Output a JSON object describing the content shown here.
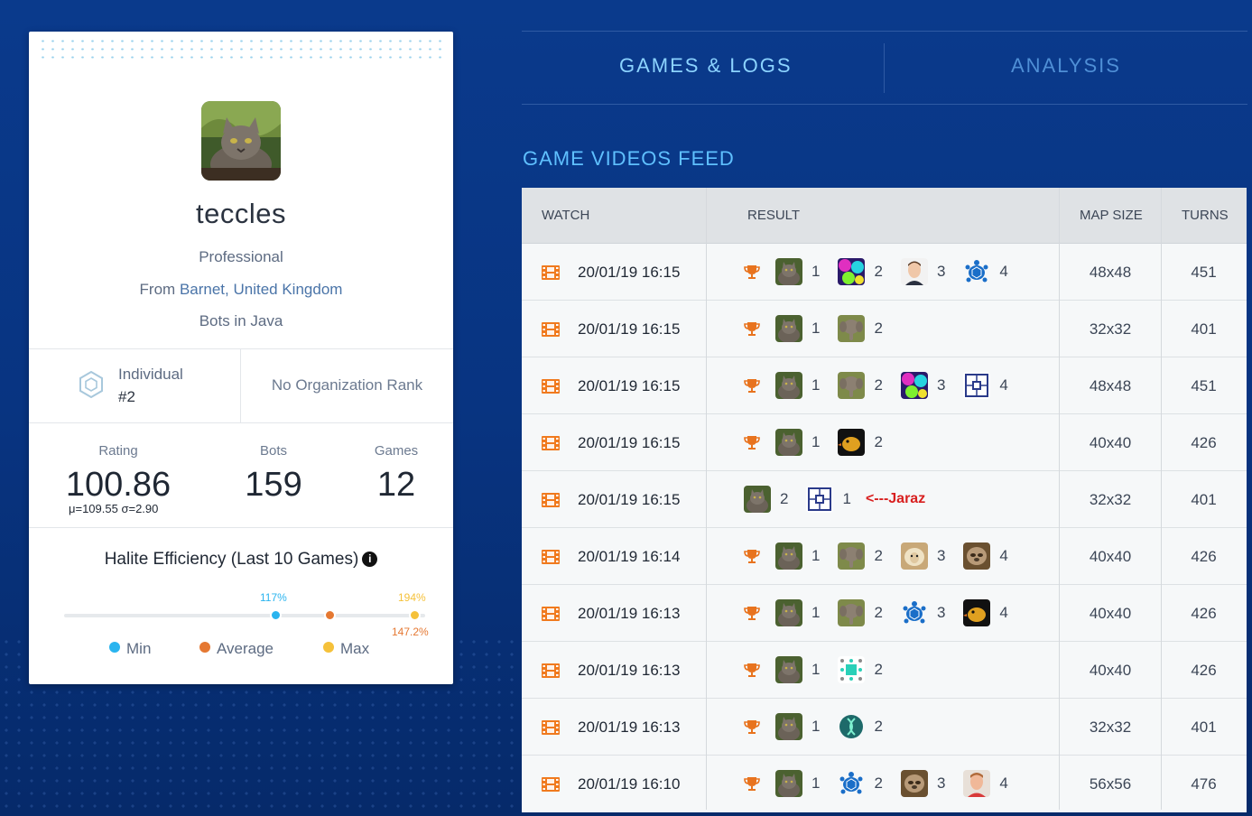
{
  "profile": {
    "username": "teccles",
    "level": "Professional",
    "from_prefix": "From ",
    "location": "Barnet, United Kingdom",
    "bots_in": "Bots in Java",
    "rank_type": "Individual",
    "rank_value": "#2",
    "org_rank": "No Organization Rank",
    "stats": {
      "rating_label": "Rating",
      "rating_value": "100.86",
      "rating_sub": "μ=109.55 σ=2.90",
      "bots_label": "Bots",
      "bots_value": "159",
      "games_label": "Games",
      "games_value": "12"
    },
    "efficiency": {
      "title": "Halite Efficiency (Last 10 Games)",
      "min_pct": "117%",
      "avg_pct": "147.2%",
      "max_pct": "194%",
      "min_value": 117,
      "avg_value": 147.2,
      "max_value": 194,
      "legend_min": "Min",
      "legend_avg": "Average",
      "legend_max": "Max",
      "colors": {
        "min": "#2ab4ef",
        "avg": "#e57832",
        "max": "#f5c13a"
      }
    }
  },
  "tabs": [
    {
      "label": "GAMES & LOGS",
      "active": true
    },
    {
      "label": "ANALYSIS",
      "active": false
    }
  ],
  "feed": {
    "title": "GAME VIDEOS FEED",
    "headers": {
      "watch": "WATCH",
      "result": "RESULT",
      "map_size": "MAP SIZE",
      "turns": "TURNS"
    },
    "rows": [
      {
        "date": "20/01/19 16:15",
        "trophy": true,
        "players": [
          [
            "cat",
            "1"
          ],
          [
            "neon",
            "2"
          ],
          [
            "man",
            "3"
          ],
          [
            "turtle",
            "4"
          ]
        ],
        "note": "",
        "map": "48x48",
        "turns": "451"
      },
      {
        "date": "20/01/19 16:15",
        "trophy": true,
        "players": [
          [
            "cat",
            "1"
          ],
          [
            "elephant",
            "2"
          ]
        ],
        "note": "",
        "map": "32x32",
        "turns": "401"
      },
      {
        "date": "20/01/19 16:15",
        "trophy": true,
        "players": [
          [
            "cat",
            "1"
          ],
          [
            "elephant",
            "2"
          ],
          [
            "neon",
            "3"
          ],
          [
            "quilt",
            "4"
          ]
        ],
        "note": "",
        "map": "48x48",
        "turns": "451"
      },
      {
        "date": "20/01/19 16:15",
        "trophy": true,
        "players": [
          [
            "cat",
            "1"
          ],
          [
            "bird",
            "2"
          ]
        ],
        "note": "",
        "map": "40x40",
        "turns": "426"
      },
      {
        "date": "20/01/19 16:15",
        "trophy": false,
        "players": [
          [
            "cat",
            "2"
          ],
          [
            "quilt",
            "1"
          ]
        ],
        "note": "<---Jaraz",
        "map": "32x32",
        "turns": "401"
      },
      {
        "date": "20/01/19 16:14",
        "trophy": true,
        "players": [
          [
            "cat",
            "1"
          ],
          [
            "elephant",
            "2"
          ],
          [
            "sheep",
            "3"
          ],
          [
            "sloth",
            "4"
          ]
        ],
        "note": "",
        "map": "40x40",
        "turns": "426"
      },
      {
        "date": "20/01/19 16:13",
        "trophy": true,
        "players": [
          [
            "cat",
            "1"
          ],
          [
            "elephant",
            "2"
          ],
          [
            "turtle",
            "3"
          ],
          [
            "bird",
            "4"
          ]
        ],
        "note": "",
        "map": "40x40",
        "turns": "426"
      },
      {
        "date": "20/01/19 16:13",
        "trophy": true,
        "players": [
          [
            "cat",
            "1"
          ],
          [
            "pattern",
            "2"
          ]
        ],
        "note": "",
        "map": "40x40",
        "turns": "426"
      },
      {
        "date": "20/01/19 16:13",
        "trophy": true,
        "players": [
          [
            "cat",
            "1"
          ],
          [
            "dna",
            "2"
          ]
        ],
        "note": "",
        "map": "32x32",
        "turns": "401"
      },
      {
        "date": "20/01/19 16:10",
        "trophy": true,
        "players": [
          [
            "cat",
            "1"
          ],
          [
            "turtle",
            "2"
          ],
          [
            "sloth",
            "3"
          ],
          [
            "redman",
            "4"
          ]
        ],
        "note": "",
        "map": "56x56",
        "turns": "476"
      }
    ]
  }
}
